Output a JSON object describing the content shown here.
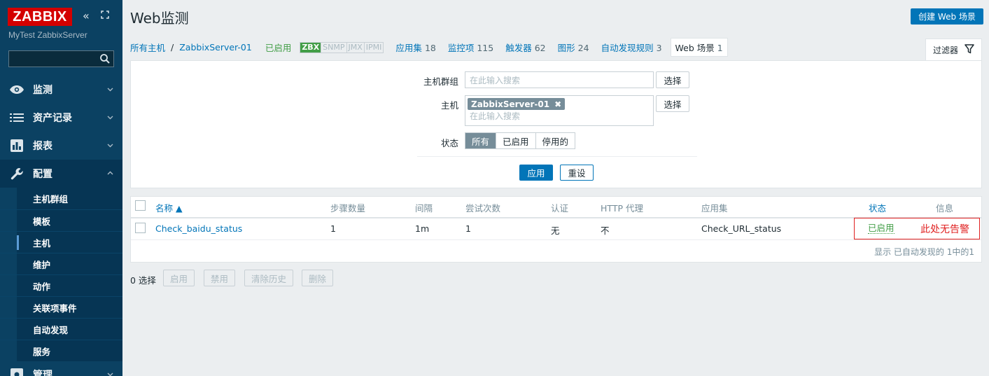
{
  "sidebar": {
    "logo": "ZABBIX",
    "server_name": "MyTest ZabbixServer",
    "nav": [
      {
        "label": "监测",
        "icon": "eye-icon"
      },
      {
        "label": "资产记录",
        "icon": "list-icon"
      },
      {
        "label": "报表",
        "icon": "bar-chart-icon"
      },
      {
        "label": "配置",
        "icon": "wrench-icon"
      },
      {
        "label": "管理",
        "icon": "gear-icon"
      }
    ],
    "config_items": [
      "主机群组",
      "模板",
      "主机",
      "维护",
      "动作",
      "关联项事件",
      "自动发现",
      "服务"
    ],
    "selected_item": "主机"
  },
  "header": {
    "title": "Web监测",
    "create_button": "创建 Web 场景"
  },
  "hostnav": {
    "all_hosts": "所有主机",
    "separator": "/",
    "host": "ZabbixServer-01",
    "status": "已启用",
    "availability": [
      "ZBX",
      "SNMP",
      "JMX",
      "IPMI"
    ],
    "links": [
      {
        "label": "应用集",
        "count": "18"
      },
      {
        "label": "监控项",
        "count": "115"
      },
      {
        "label": "触发器",
        "count": "62"
      },
      {
        "label": "图形",
        "count": "24"
      },
      {
        "label": "自动发现规则",
        "count": "3"
      }
    ],
    "active": {
      "label": "Web 场景",
      "count": "1"
    }
  },
  "filter": {
    "tab_label": "过滤器",
    "host_group_label": "主机群组",
    "host_group_placeholder": "在此输入搜索",
    "host_label": "主机",
    "host_chip": "ZabbixServer-01",
    "host_placeholder": "在此输入搜索",
    "select_button": "选择",
    "status_label": "状态",
    "status_options": [
      "所有",
      "已启用",
      "停用的"
    ],
    "apply": "应用",
    "reset": "重设"
  },
  "table": {
    "columns": [
      "名称 ▲",
      "步骤数量",
      "间隔",
      "尝试次数",
      "认证",
      "HTTP 代理",
      "应用集",
      "状态",
      "信息"
    ],
    "rows": [
      {
        "name": "Check_baidu_status",
        "steps": "1",
        "interval": "1m",
        "attempts": "1",
        "auth": "无",
        "proxy": "不",
        "application": "Check_URL_status",
        "status": "已启用"
      }
    ],
    "footer": "显示 已自动发现的 1中的1",
    "annotation": "此处无告警"
  },
  "actions": {
    "selected": "0 选择",
    "buttons": [
      "启用",
      "禁用",
      "清除历史",
      "删除"
    ]
  },
  "colors": {
    "sidebar": "#0b4162",
    "accent": "#0275b8",
    "enabled": "#429e47",
    "logo": "#d40000",
    "annotation": "#e02020"
  }
}
